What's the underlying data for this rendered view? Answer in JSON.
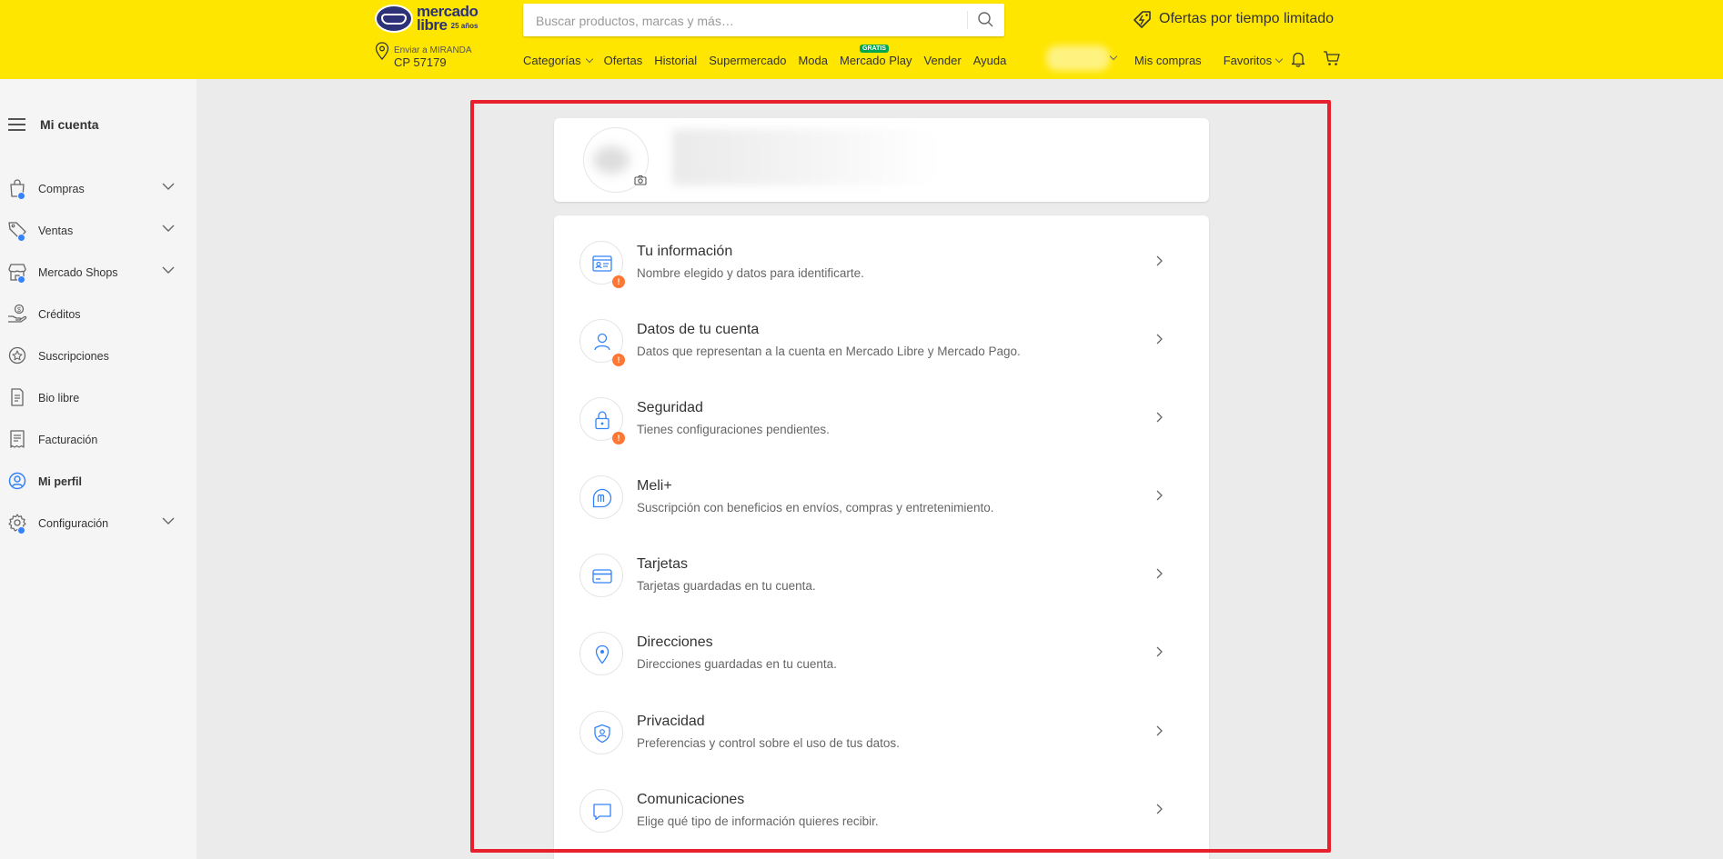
{
  "header": {
    "logo_line1": "mercado",
    "logo_line2": "libre",
    "logo_years": "25 años",
    "search_placeholder": "Buscar productos, marcas y más…",
    "promo": "Ofertas por tiempo limitado",
    "location_line1": "Enviar a MIRANDA",
    "location_line2": "CP 57179",
    "nav": [
      {
        "label": "Categorías"
      },
      {
        "label": "Ofertas"
      },
      {
        "label": "Historial"
      },
      {
        "label": "Supermercado"
      },
      {
        "label": "Moda"
      },
      {
        "label": "Mercado Play",
        "badge": "GRATIS"
      },
      {
        "label": "Vender"
      },
      {
        "label": "Ayuda"
      }
    ],
    "right_nav": {
      "purchases": "Mis compras",
      "favorites": "Favoritos"
    }
  },
  "sidebar": {
    "title": "Mi cuenta",
    "items": [
      {
        "label": "Compras",
        "icon": "bag-icon",
        "dot": true,
        "expandable": true
      },
      {
        "label": "Ventas",
        "icon": "tag-icon",
        "dot": true,
        "expandable": true
      },
      {
        "label": "Mercado Shops",
        "icon": "shop-icon",
        "dot": true,
        "expandable": true
      },
      {
        "label": "Créditos",
        "icon": "credit-hand-icon",
        "dot": false,
        "expandable": false
      },
      {
        "label": "Suscripciones",
        "icon": "subscription-icon",
        "dot": false,
        "expandable": false
      },
      {
        "label": "Bio libre",
        "icon": "bio-icon",
        "dot": false,
        "expandable": false
      },
      {
        "label": "Facturación",
        "icon": "receipt-icon",
        "dot": false,
        "expandable": false
      },
      {
        "label": "Mi perfil",
        "icon": "profile-icon",
        "dot": false,
        "expandable": false,
        "active": true
      },
      {
        "label": "Configuración",
        "icon": "gear-icon",
        "dot": true,
        "expandable": true
      }
    ]
  },
  "menu": [
    {
      "title": "Tu información",
      "desc": "Nombre elegido y datos para identificarte.",
      "icon": "id-card-icon",
      "alert": true
    },
    {
      "title": "Datos de tu cuenta",
      "desc": "Datos que representan a la cuenta en Mercado Libre y Mercado Pago.",
      "icon": "user-icon",
      "alert": true
    },
    {
      "title": "Seguridad",
      "desc": "Tienes configuraciones pendientes.",
      "icon": "lock-icon",
      "alert": true
    },
    {
      "title": "Meli+",
      "desc": "Suscripción con beneficios en envíos, compras y entretenimiento.",
      "icon": "meli-plus-icon",
      "alert": false
    },
    {
      "title": "Tarjetas",
      "desc": "Tarjetas guardadas en tu cuenta.",
      "icon": "card-icon",
      "alert": false
    },
    {
      "title": "Direcciones",
      "desc": "Direcciones guardadas en tu cuenta.",
      "icon": "location-icon",
      "alert": false
    },
    {
      "title": "Privacidad",
      "desc": "Preferencias y control sobre el uso de tus datos.",
      "icon": "privacy-shield-icon",
      "alert": false
    },
    {
      "title": "Comunicaciones",
      "desc": "Elige qué tipo de información quieres recibir.",
      "icon": "chat-icon",
      "alert": false
    }
  ],
  "alert_mark": "!",
  "colors": {
    "header_bg": "#ffe600",
    "accent_blue": "#3483fa",
    "alert_orange": "#ff7733",
    "highlight_frame": "#e8202e"
  }
}
